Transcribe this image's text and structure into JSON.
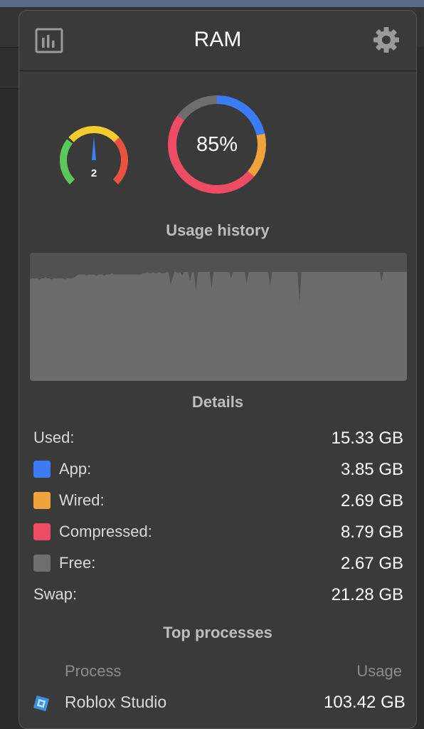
{
  "header": {
    "title": "RAM",
    "left_icon": "bar-chart-icon",
    "right_icon": "gear-icon"
  },
  "pressure_gauge": {
    "value": "2",
    "level": 2,
    "level_max": 3,
    "colors": [
      "#5ac85a",
      "#f5cc2e",
      "#e8523f"
    ],
    "needle_color": "#3b82f6"
  },
  "usage_donut": {
    "label": "85%",
    "percent": 85,
    "segments": [
      {
        "name": "App",
        "fraction": 0.2516,
        "color": "#3b7cf6"
      },
      {
        "name": "Wired",
        "fraction": 0.1758,
        "color": "#f0a23c"
      },
      {
        "name": "Compressed",
        "fraction": 0.5745,
        "color": "#ee4b64"
      },
      {
        "name": "Free",
        "fraction": 0.1745,
        "color": "#6e6e6e"
      }
    ]
  },
  "usage_history": {
    "title": "Usage history",
    "fill_color": "#6c6c6c",
    "values_percent": [
      79,
      80,
      80,
      80,
      80,
      79,
      80,
      80,
      81,
      80,
      80,
      79,
      80,
      80,
      80,
      80,
      80,
      80,
      79,
      80,
      80,
      80,
      80,
      81,
      82,
      83,
      83,
      83,
      83,
      82,
      83,
      83,
      83,
      83,
      82,
      83,
      83,
      83,
      82,
      83,
      83,
      83,
      84,
      83,
      83,
      83,
      83,
      83,
      83,
      83,
      83,
      83,
      83,
      83,
      83,
      83,
      83,
      83,
      84,
      84,
      85,
      84,
      84,
      85,
      84,
      84,
      85,
      84,
      84,
      84,
      85,
      85,
      75,
      80,
      85,
      85,
      84,
      85,
      82,
      85,
      85,
      85,
      78,
      85,
      85,
      70,
      85,
      85,
      85,
      85,
      85,
      85,
      85,
      72,
      85,
      85,
      85,
      85,
      85,
      85,
      85,
      85,
      85,
      80,
      85,
      85,
      85,
      85,
      85,
      85,
      85,
      76,
      85,
      85,
      85,
      85,
      85,
      85,
      85,
      85,
      85,
      85,
      85,
      74,
      85,
      85,
      85,
      85,
      85,
      85,
      85,
      85,
      85,
      85,
      85,
      85,
      85,
      85,
      60,
      85,
      85,
      85,
      85,
      85,
      85,
      85,
      85,
      85,
      85,
      85,
      85,
      85,
      85,
      85,
      85,
      85,
      85,
      85,
      85,
      85,
      85,
      85,
      85,
      85,
      85,
      85,
      85,
      85,
      85,
      85,
      85,
      85,
      85,
      85,
      85,
      85,
      85,
      85,
      85,
      85,
      78,
      85,
      85,
      85,
      85,
      85,
      85,
      85,
      85,
      85,
      85,
      85,
      85,
      85
    ]
  },
  "details": {
    "title": "Details",
    "used": {
      "label": "Used:",
      "value": "15.33 GB"
    },
    "app": {
      "label": "App:",
      "value": "3.85 GB",
      "color": "#3b7cf6"
    },
    "wired": {
      "label": "Wired:",
      "value": "2.69 GB",
      "color": "#f0a23c"
    },
    "compressed": {
      "label": "Compressed:",
      "value": "8.79 GB",
      "color": "#ee4b64"
    },
    "free": {
      "label": "Free:",
      "value": "2.67 GB",
      "color": "#6e6e6e"
    },
    "swap": {
      "label": "Swap:",
      "value": "21.28 GB"
    }
  },
  "top_processes": {
    "title": "Top processes",
    "col_process": "Process",
    "col_usage": "Usage",
    "rows": [
      {
        "icon": "roblox-studio-icon",
        "name": "Roblox Studio",
        "usage": "103.42 GB"
      }
    ]
  }
}
